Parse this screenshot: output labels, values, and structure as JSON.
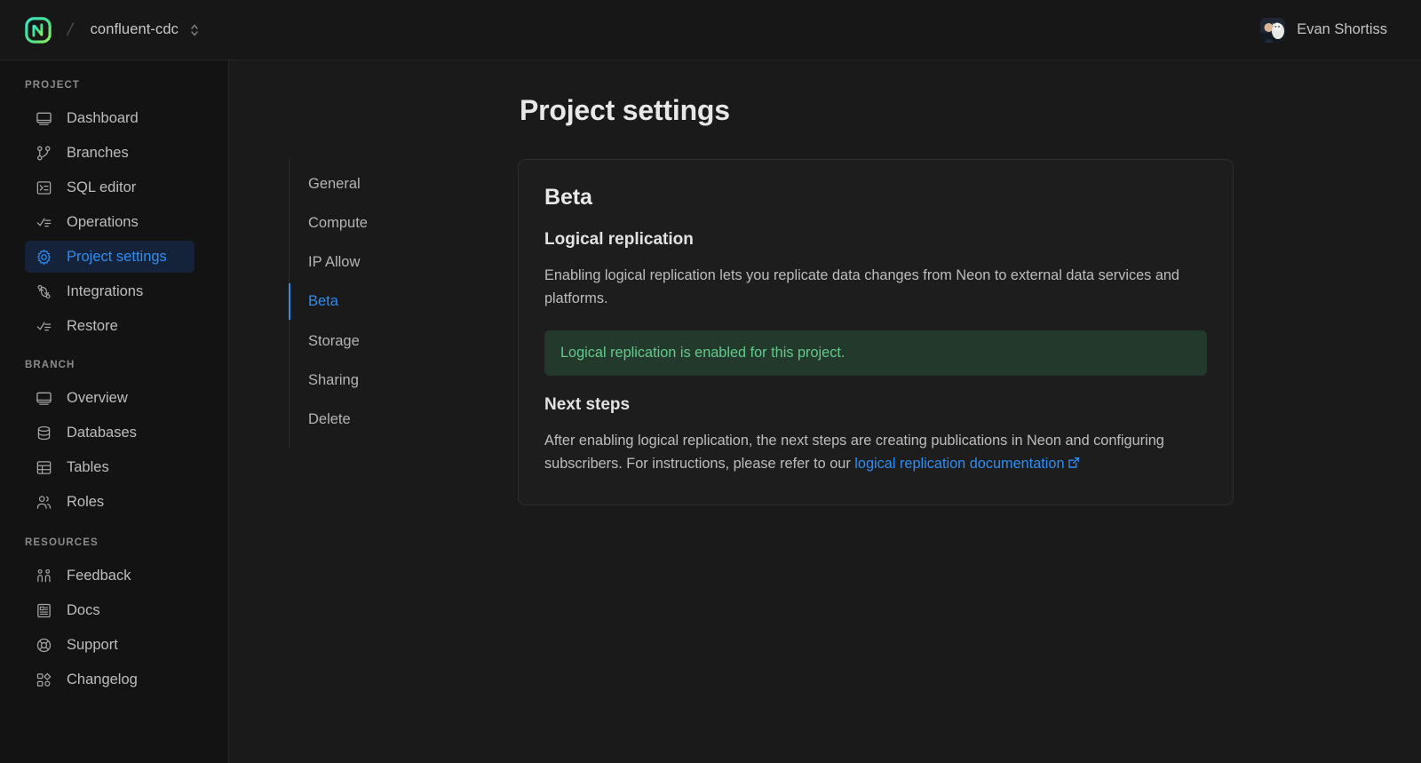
{
  "topbar": {
    "logo_name": "neon-logo",
    "separator": "/",
    "project_name": "confluent-cdc",
    "switcher_icon": "chevron-up-down-icon",
    "user_name": "Evan Shortiss",
    "avatar_alt": "user-avatar"
  },
  "sidebar": {
    "groups": [
      {
        "title": "PROJECT",
        "items": [
          {
            "label": "Dashboard",
            "icon": "dashboard-icon",
            "active": false
          },
          {
            "label": "Branches",
            "icon": "branches-icon",
            "active": false
          },
          {
            "label": "SQL editor",
            "icon": "sql-editor-icon",
            "active": false
          },
          {
            "label": "Operations",
            "icon": "operations-icon",
            "active": false
          },
          {
            "label": "Project settings",
            "icon": "gear-icon",
            "active": true
          },
          {
            "label": "Integrations",
            "icon": "integrations-icon",
            "active": false
          },
          {
            "label": "Restore",
            "icon": "restore-icon",
            "active": false
          }
        ]
      },
      {
        "title": "BRANCH",
        "items": [
          {
            "label": "Overview",
            "icon": "overview-icon",
            "active": false
          },
          {
            "label": "Databases",
            "icon": "database-icon",
            "active": false
          },
          {
            "label": "Tables",
            "icon": "table-icon",
            "active": false
          },
          {
            "label": "Roles",
            "icon": "users-icon",
            "active": false
          }
        ]
      },
      {
        "title": "RESOURCES",
        "items": [
          {
            "label": "Feedback",
            "icon": "feedback-icon",
            "active": false
          },
          {
            "label": "Docs",
            "icon": "docs-icon",
            "active": false
          },
          {
            "label": "Support",
            "icon": "lifebuoy-icon",
            "active": false
          },
          {
            "label": "Changelog",
            "icon": "changelog-icon",
            "active": false
          }
        ]
      }
    ]
  },
  "main": {
    "page_title": "Project settings",
    "subnav": [
      {
        "label": "General",
        "active": false
      },
      {
        "label": "Compute",
        "active": false
      },
      {
        "label": "IP Allow",
        "active": false
      },
      {
        "label": "Beta",
        "active": true
      },
      {
        "label": "Storage",
        "active": false
      },
      {
        "label": "Sharing",
        "active": false
      },
      {
        "label": "Delete",
        "active": false
      }
    ],
    "card": {
      "title": "Beta",
      "section_title": "Logical replication",
      "description": "Enabling logical replication lets you replicate data changes from Neon to external data services and platforms.",
      "alert_text": "Logical replication is enabled for this project.",
      "next_steps_title": "Next steps",
      "next_steps_text_before": "After enabling logical replication, the next steps are creating publications in Neon and configuring subscribers. For instructions, please refer to our ",
      "next_steps_link": "logical replication documentation",
      "external_link_icon": "external-link-icon"
    }
  },
  "colors": {
    "accent_blue": "#2f8cf2",
    "active_nav_bg": "#15233a",
    "success_bg": "#23392c",
    "success_text": "#63c98c",
    "brand_green": "#4ade80",
    "page_bg": "#1a1a1a",
    "sidebar_bg": "#131313",
    "card_bg": "#1d1d1d"
  }
}
